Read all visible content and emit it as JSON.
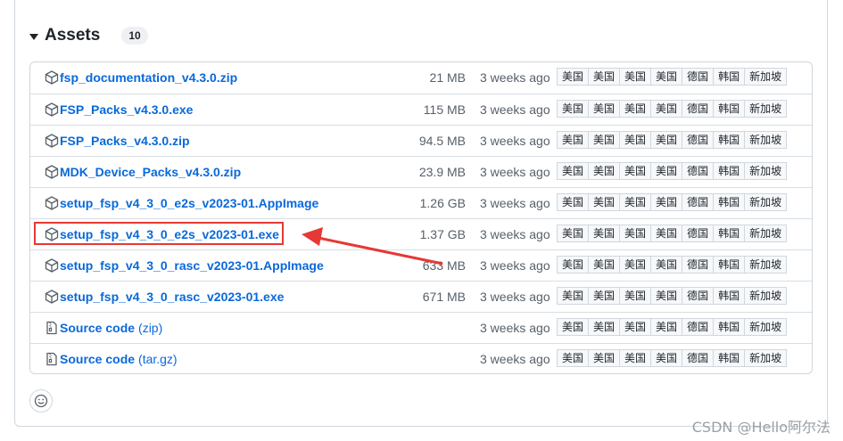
{
  "assets": {
    "title": "Assets",
    "count": "10"
  },
  "files": [
    {
      "name": "fsp_documentation_v4.3.0.zip",
      "suffix": "",
      "size": "21 MB",
      "time": "3 weeks ago",
      "icon": "package-icon"
    },
    {
      "name": "FSP_Packs_v4.3.0.exe",
      "suffix": "",
      "size": "115 MB",
      "time": "3 weeks ago",
      "icon": "package-icon"
    },
    {
      "name": "FSP_Packs_v4.3.0.zip",
      "suffix": "",
      "size": "94.5 MB",
      "time": "3 weeks ago",
      "icon": "package-icon"
    },
    {
      "name": "MDK_Device_Packs_v4.3.0.zip",
      "suffix": "",
      "size": "23.9 MB",
      "time": "3 weeks ago",
      "icon": "package-icon"
    },
    {
      "name": "setup_fsp_v4_3_0_e2s_v2023-01.AppImage",
      "suffix": "",
      "size": "1.26 GB",
      "time": "3 weeks ago",
      "icon": "package-icon"
    },
    {
      "name": "setup_fsp_v4_3_0_e2s_v2023-01.exe",
      "suffix": "",
      "size": "1.37 GB",
      "time": "3 weeks ago",
      "icon": "package-icon"
    },
    {
      "name": "setup_fsp_v4_3_0_rasc_v2023-01.AppImage",
      "suffix": "",
      "size": "633 MB",
      "time": "3 weeks ago",
      "icon": "package-icon"
    },
    {
      "name": "setup_fsp_v4_3_0_rasc_v2023-01.exe",
      "suffix": "",
      "size": "671 MB",
      "time": "3 weeks ago",
      "icon": "package-icon"
    },
    {
      "name": "Source code",
      "suffix": "(zip)",
      "size": "",
      "time": "3 weeks ago",
      "icon": "file-zip-icon"
    },
    {
      "name": "Source code",
      "suffix": "(tar.gz)",
      "size": "",
      "time": "3 weeks ago",
      "icon": "file-zip-icon"
    }
  ],
  "mirrors": [
    "美国",
    "美国",
    "美国",
    "美国",
    "德国",
    "韩国",
    "新加坡"
  ],
  "watermark": "CSDN @Hello阿尔法",
  "colors": {
    "link": "#0969da",
    "highlight": "#e53935",
    "border": "#d0d7de"
  }
}
